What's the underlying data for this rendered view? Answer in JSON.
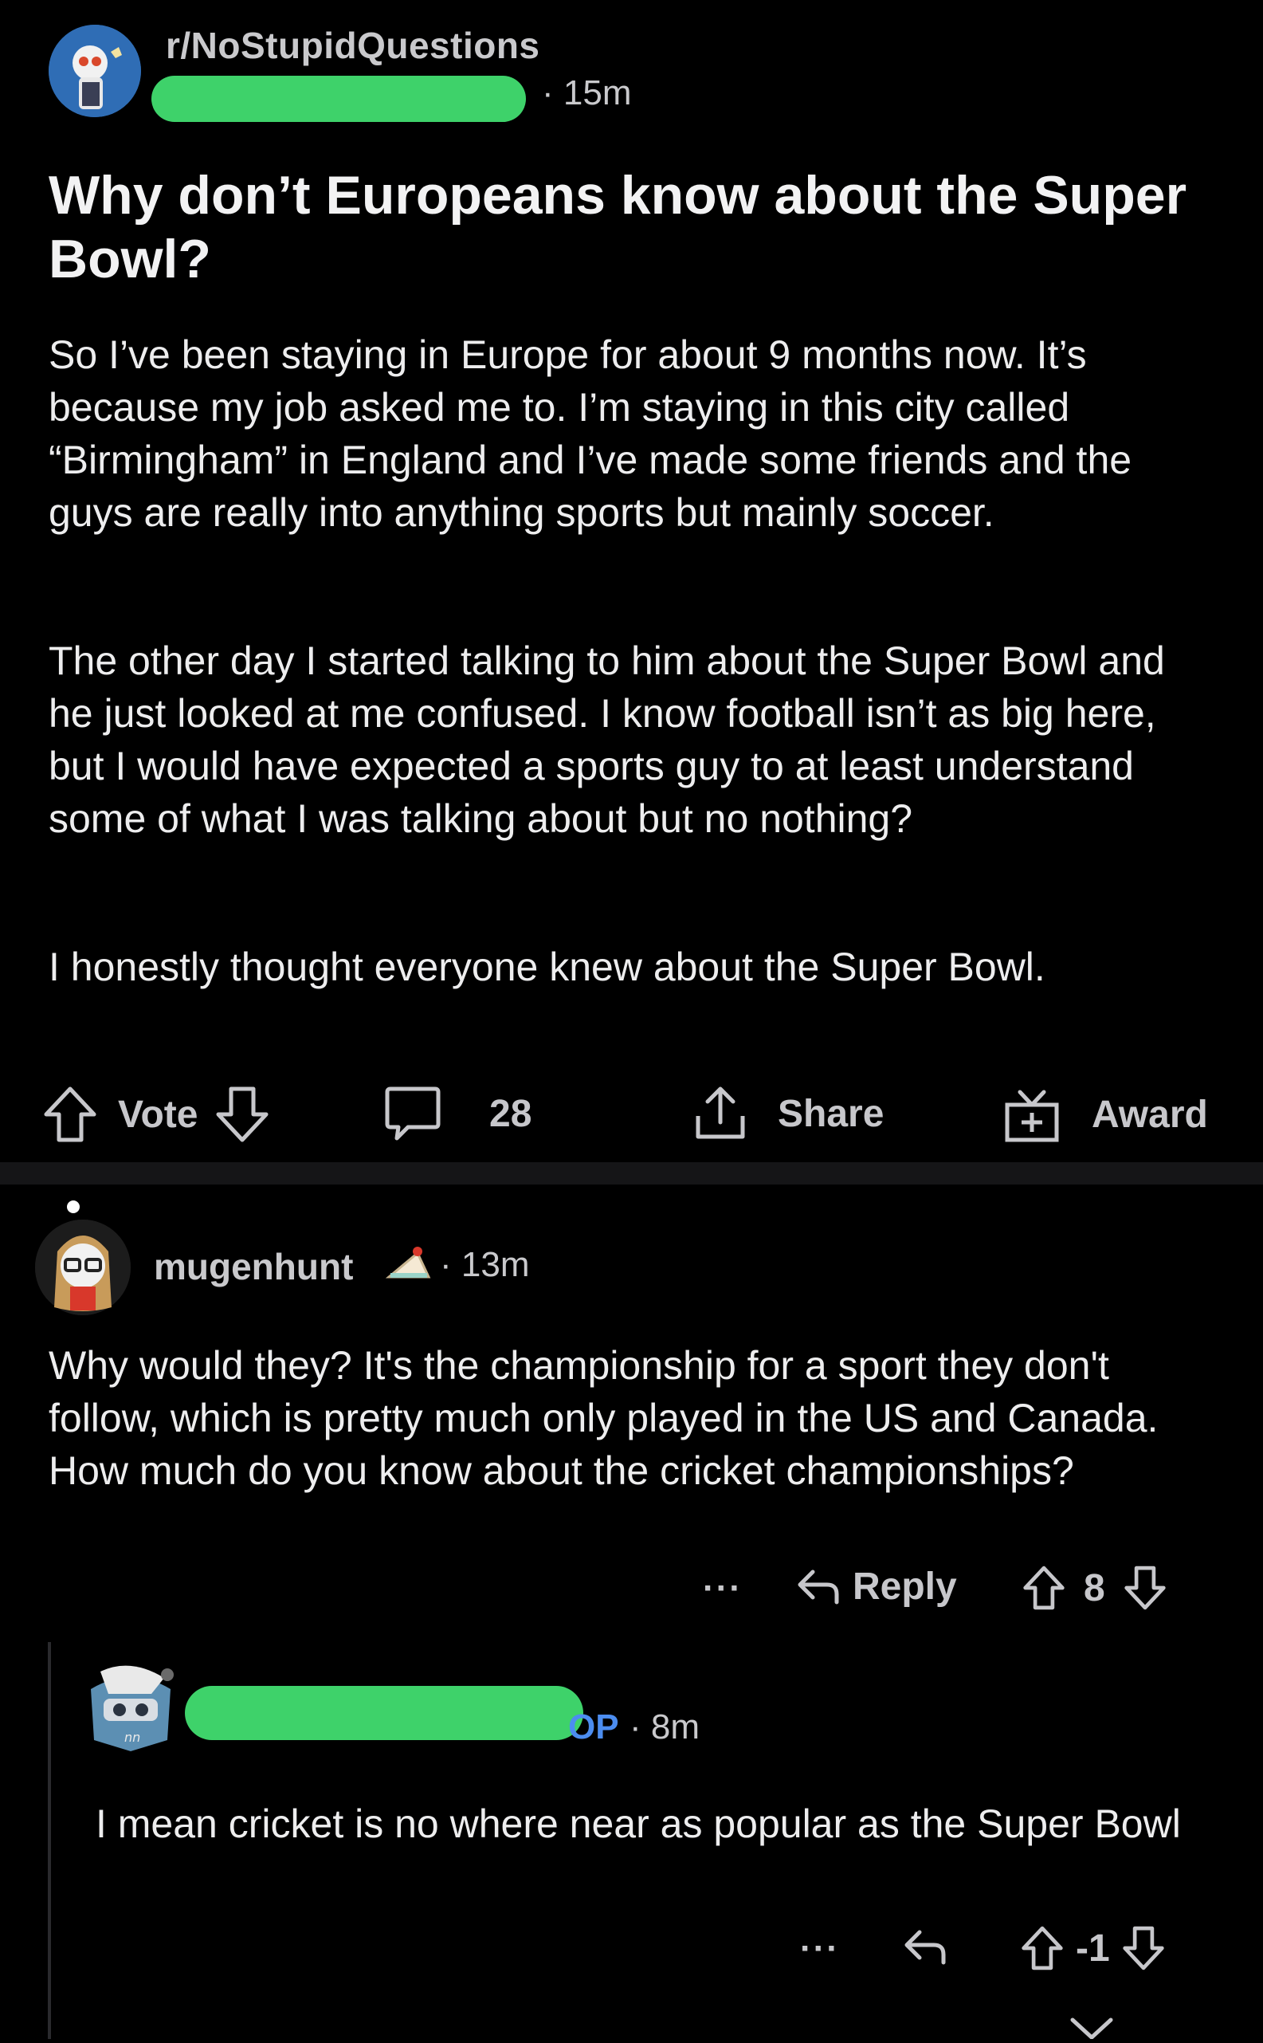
{
  "post": {
    "subreddit": "r/NoStupidQuestions",
    "time": "· 15m",
    "title": "Why don’t Europeans know about the Super Bowl?",
    "paragraphs": [
      "So I’ve been staying in Europe for about 9 months now. It’s because my job asked me to. I’m staying in this city called “Birmingham” in England and I’ve made some friends and the guys are really into anything sports but mainly soccer.",
      "The other day I started talking to him about the Super Bowl and he just looked at me confused. I know football isn’t as big here, but I would have expected a sports guy to at least understand some of what I was talking about but no nothing?",
      "I honestly thought everyone knew about the Super Bowl."
    ],
    "actions": {
      "vote_label": "Vote",
      "comments_count": "28",
      "share_label": "Share",
      "award_label": "Award"
    }
  },
  "comment": {
    "username": "mugenhunt",
    "time": "· 13m",
    "text": "Why would they? It's the championship for a sport they don't follow, which is pretty much only played in the US and Canada. How much do you know about the cricket championships?",
    "more_label": "···",
    "reply_label": "Reply",
    "score": "8"
  },
  "reply": {
    "op_badge": "OP",
    "time": "· 8m",
    "text": "I mean cricket is no where near as popular as the Super Bowl",
    "more_label": "···",
    "score": "-1"
  },
  "colors": {
    "background": "#000000",
    "text": "#e9e9ea",
    "muted": "#c7c7cb",
    "op_blue": "#4c8df0",
    "redaction_green": "#3ed26a"
  }
}
